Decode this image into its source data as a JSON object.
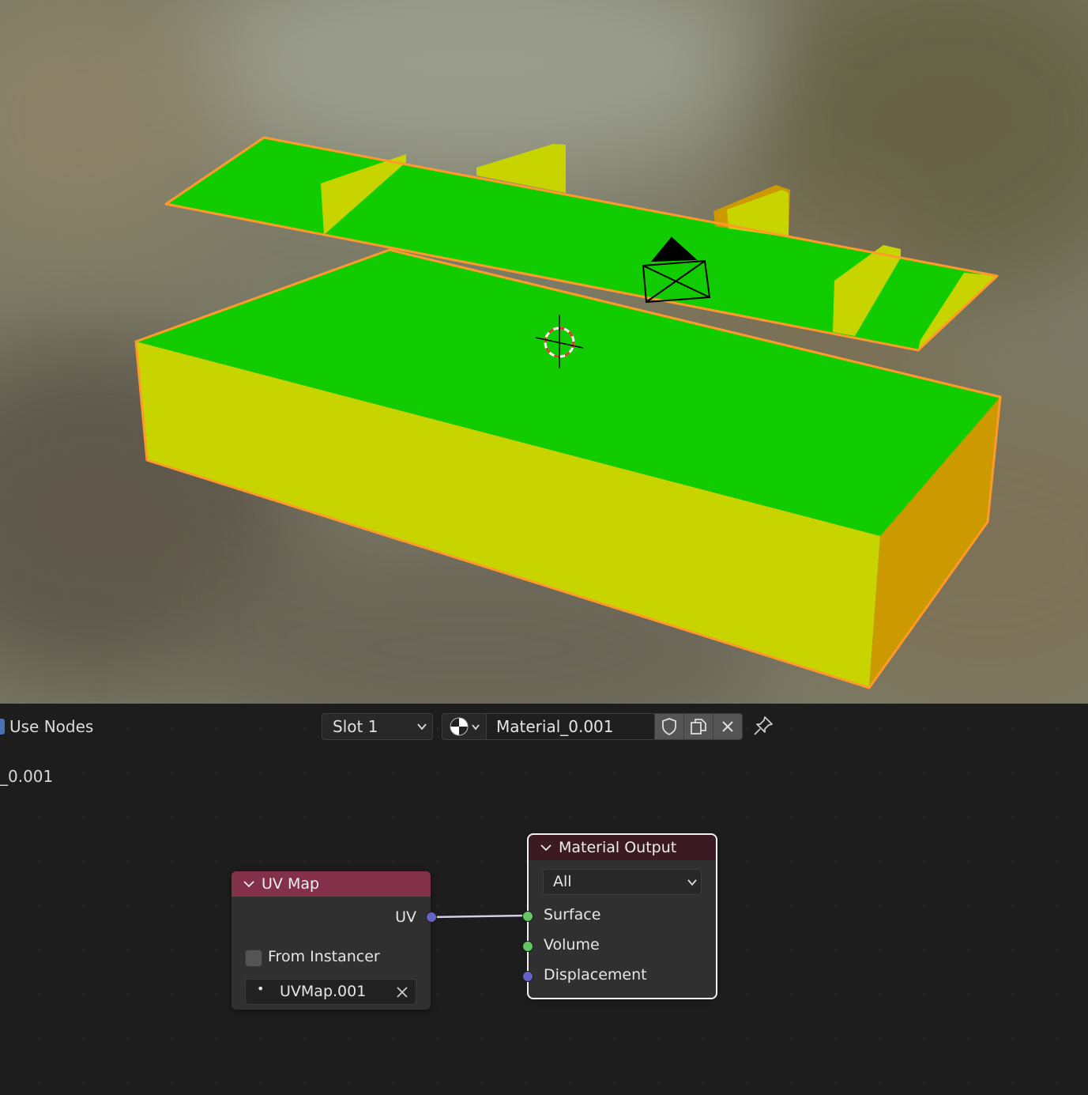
{
  "header": {
    "use_nodes_label": "Use Nodes",
    "slot_label": "Slot 1",
    "material_name": "Material_0.001"
  },
  "tree_path": "_0.001",
  "nodes": {
    "uv_map": {
      "title": "UV Map",
      "output_uv": "UV",
      "from_instancer_label": "From Instancer",
      "from_instancer_checked": false,
      "uv_map_value": "UVMap.001"
    },
    "material_output": {
      "title": "Material Output",
      "target": "All",
      "inputs": [
        "Surface",
        "Volume",
        "Displacement"
      ]
    }
  },
  "colors": {
    "top_face": "#11cc00",
    "side_face": "#c8d400",
    "end_face": "#cc9900",
    "selection_outline": "#ff9a2a",
    "uv_header": "#83314a",
    "output_header": "#3b1a22",
    "vector_socket": "#6363c7",
    "shader_socket": "#63c763"
  }
}
